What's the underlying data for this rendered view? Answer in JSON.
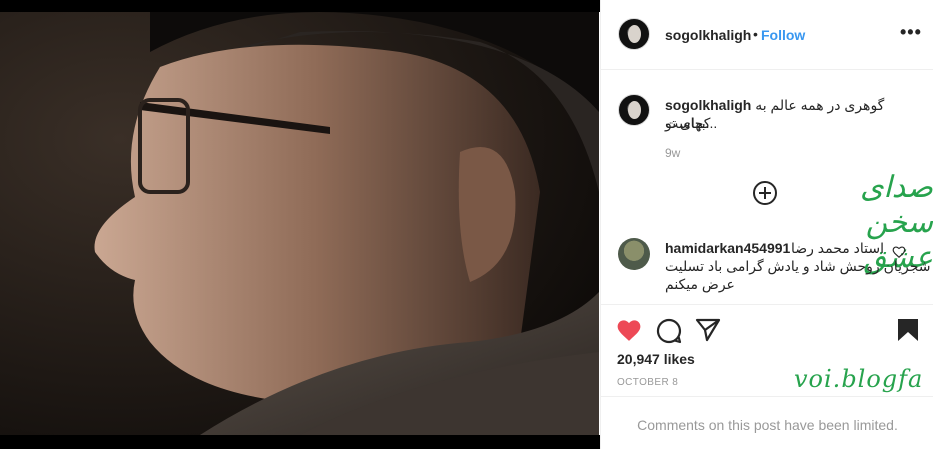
{
  "post": {
    "image_alt": "portrait",
    "username": "sogolkhaligh",
    "separator": "•",
    "follow_label": "Follow",
    "more_label": "•••"
  },
  "caption": {
    "username": "sogolkhaligh",
    "text_line1": "گوهری در همه عالم به بهای تو...",
    "text_line2": "کجاست",
    "time": "9w"
  },
  "overlay": {
    "title_fa": "صدای سخن عشق",
    "blog_label": "voi.blogfa"
  },
  "comment": {
    "username": "hamidarkan454991",
    "line1": "استاد محمد رضا",
    "line2": "شجریان روحش شاد و یادش گرامی باد تسلیت",
    "line3": "عرض میکنم"
  },
  "stats": {
    "likes": "20,947 likes",
    "date": "OCTOBER 8"
  },
  "footer": {
    "limited_text": "Comments on this post have been limited."
  },
  "colors": {
    "accent": "#3897f0",
    "like_red": "#ed4956",
    "watermark_green": "#27a34d"
  }
}
